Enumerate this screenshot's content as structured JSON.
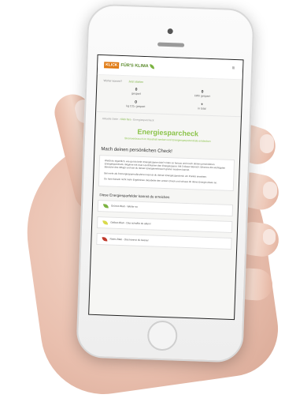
{
  "header": {
    "logo_box": "KLICK",
    "logo_text": "FÜR'S KLIMA",
    "menu_glyph": "≡"
  },
  "crumbs": {
    "left": "Woher kommt?",
    "right": "Jetzt starten"
  },
  "stats": [
    {
      "value": "0",
      "label": "gespart"
    },
    {
      "value": "0",
      "label": "kWh gespart"
    },
    {
      "value": "0",
      "label": "kg CO₂ gespart"
    },
    {
      "value": "+",
      "label": "in total"
    }
  ],
  "path": {
    "a": "Aktuelle Seite",
    "b": "Klick fürs",
    "c": "Energiesparcheck"
  },
  "main": {
    "title": "Energiesparcheck",
    "subtitle": "Stromverbrauch im Haushalt senken und Energiesparpotenziale entdecken",
    "heading": "Mach deinen persönlichen Check!",
    "paragraphs": [
      "Weißt du eigentlich, wie gut du beim Energiesparen bist? Finde es heraus und mach deinen persönlichen Energiesparcheck. Beginne mit zwei Leuchtkarten den Energiesparer. Mit 3 dieser Bereich: Erkenne die wichtigsten Bereiche des Alltags und wie du deinen Energieverbrauch grüner machen kannst.",
      "Bei mehr als 8 Energiesparmaßnahmen kannst du deinen Energiesparcheck um Punkte erweitern.",
      "Du hast danach nicht mehr Ergebnisse. Bearbeite den ersten Check und schaue dir deine Energie-Ideen an."
    ],
    "levels_heading": "Diese Energiesparfelder kannst du erreichen",
    "levels": [
      {
        "label": "Grünes Blatt - Weiter so",
        "color": "#7cb342"
      },
      {
        "label": "Gelbes Blatt - Das schaffst du allein!",
        "color": "#d9d94a"
      },
      {
        "label": "Rotes Blatt - Das kannst du besser",
        "color": "#c0392b"
      }
    ]
  }
}
